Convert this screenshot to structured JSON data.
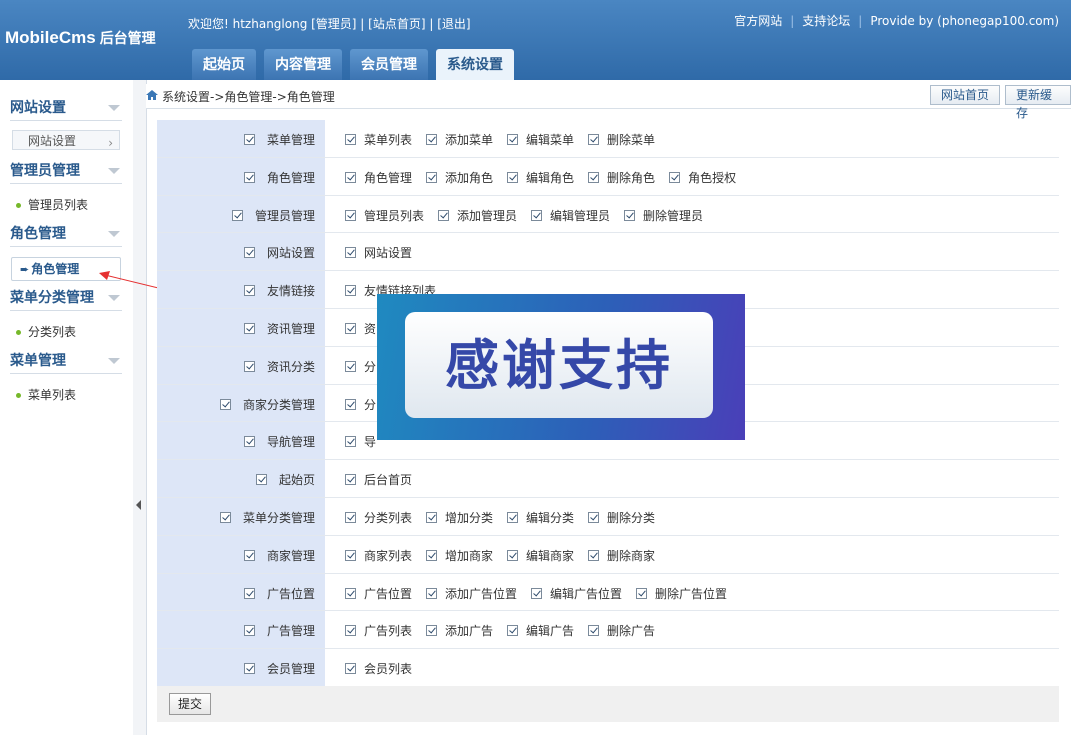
{
  "header": {
    "logo": "MobileCms",
    "logo_sub": "后台管理",
    "welcome": "欢迎您! htzhanglong [管理员] | [站点首页] | [退出]",
    "links": [
      "官方网站",
      "支持论坛",
      "Provide by (phonegap100.com)"
    ],
    "tabs": [
      "起始页",
      "内容管理",
      "会员管理",
      "系统设置"
    ]
  },
  "sidebar": {
    "groups": [
      {
        "title": "网站设置",
        "items": [
          "网站设置"
        ]
      },
      {
        "title": "管理员管理",
        "items": [
          "管理员列表"
        ]
      },
      {
        "title": "角色管理",
        "items": [
          "角色管理"
        ]
      },
      {
        "title": "菜单分类管理",
        "items": [
          "分类列表"
        ]
      },
      {
        "title": "菜单管理",
        "items": [
          "菜单列表"
        ]
      }
    ]
  },
  "breadcrumb": "系统设置->角色管理->角色管理",
  "actions": {
    "site_home": "网站首页",
    "refresh_cache": "更新缓存"
  },
  "permissions": [
    {
      "label": "菜单管理",
      "items": [
        "菜单列表",
        "添加菜单",
        "编辑菜单",
        "删除菜单"
      ]
    },
    {
      "label": "角色管理",
      "items": [
        "角色管理",
        "添加角色",
        "编辑角色",
        "删除角色",
        "角色授权"
      ]
    },
    {
      "label": "管理员管理",
      "items": [
        "管理员列表",
        "添加管理员",
        "编辑管理员",
        "删除管理员"
      ]
    },
    {
      "label": "网站设置",
      "items": [
        "网站设置"
      ]
    },
    {
      "label": "友情链接",
      "items": [
        "友情链接列表"
      ]
    },
    {
      "label": "资讯管理",
      "items": [
        "资"
      ]
    },
    {
      "label": "资讯分类",
      "items": [
        "分"
      ]
    },
    {
      "label": "商家分类管理",
      "items": [
        "分"
      ]
    },
    {
      "label": "导航管理",
      "items": [
        "导"
      ]
    },
    {
      "label": "起始页",
      "items": [
        "后台首页"
      ]
    },
    {
      "label": "菜单分类管理",
      "items": [
        "分类列表",
        "增加分类",
        "编辑分类",
        "删除分类"
      ]
    },
    {
      "label": "商家管理",
      "items": [
        "商家列表",
        "增加商家",
        "编辑商家",
        "删除商家"
      ]
    },
    {
      "label": "广告位置",
      "items": [
        "广告位置",
        "添加广告位置",
        "编辑广告位置",
        "删除广告位置"
      ]
    },
    {
      "label": "广告管理",
      "items": [
        "广告列表",
        "添加广告",
        "编辑广告",
        "删除广告"
      ]
    },
    {
      "label": "会员管理",
      "items": [
        "会员列表"
      ]
    }
  ],
  "submit_label": "提交",
  "overlay_text": "感谢支持"
}
